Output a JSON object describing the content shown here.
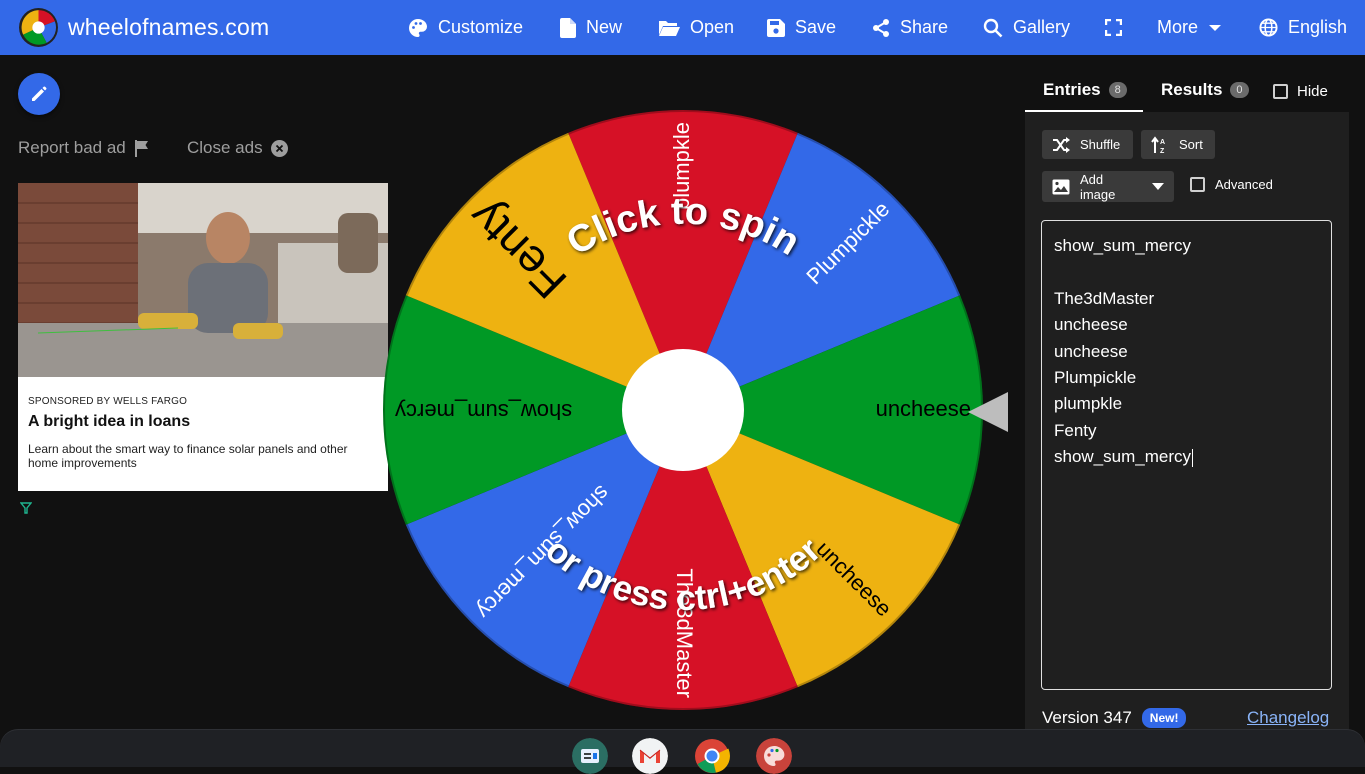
{
  "header": {
    "site_name": "wheelofnames.com",
    "nav": [
      {
        "label": "Customize",
        "icon": "palette-icon"
      },
      {
        "label": "New",
        "icon": "file-icon"
      },
      {
        "label": "Open",
        "icon": "folder-open-icon"
      },
      {
        "label": "Save",
        "icon": "save-icon"
      },
      {
        "label": "Share",
        "icon": "share-icon"
      },
      {
        "label": "Gallery",
        "icon": "search-icon"
      },
      {
        "label": "",
        "icon": "fullscreen-icon"
      },
      {
        "label": "More",
        "icon": "chevron-down-icon"
      },
      {
        "label": "English",
        "icon": "globe-icon"
      }
    ],
    "accent": "#3369e8"
  },
  "ads": {
    "report": "Report bad ad",
    "close": "Close ads",
    "sponsor": "SPONSORED BY WELLS FARGO",
    "title": "A bright idea in loans",
    "description": "Learn about the smart way to finance solar panels and other home improvements"
  },
  "wheel": {
    "segments": [
      {
        "label": "plumpkle",
        "color": "#d61126"
      },
      {
        "label": "Plumpickle",
        "color": "#3369e8"
      },
      {
        "label": "uncheese",
        "color": "#009925"
      },
      {
        "label": "uncheese",
        "color": "#eeb211"
      },
      {
        "label": "The3dMaster",
        "color": "#d61126"
      },
      {
        "label": "show_sum_mercy",
        "color": "#3369e8"
      },
      {
        "label": "show_sum_mercy",
        "color": "#009925"
      },
      {
        "label": "Fenty",
        "color": "#eeb211"
      }
    ],
    "spin_text": "Click to spin",
    "spin_subtext": "or press ctrl+enter"
  },
  "panel": {
    "tabs": [
      {
        "label": "Entries",
        "count": "8"
      },
      {
        "label": "Results",
        "count": "0"
      }
    ],
    "hide_label": "Hide",
    "shuffle_label": "Shuffle",
    "sort_label": "Sort",
    "add_image_label": "Add image",
    "advanced_label": "Advanced",
    "entries": [
      "show_sum_mercy",
      "",
      "The3dMaster",
      "uncheese",
      "uncheese",
      "Plumpickle",
      "plumpkle",
      "Fenty",
      "show_sum_mercy"
    ],
    "version": "Version 347",
    "new_badge": "New!",
    "changelog": "Changelog"
  },
  "shelf": {
    "apps": [
      {
        "icon": "app-icon"
      },
      {
        "icon": "gmail-icon"
      },
      {
        "icon": "chrome-icon"
      },
      {
        "icon": "palette-app-icon"
      }
    ]
  }
}
